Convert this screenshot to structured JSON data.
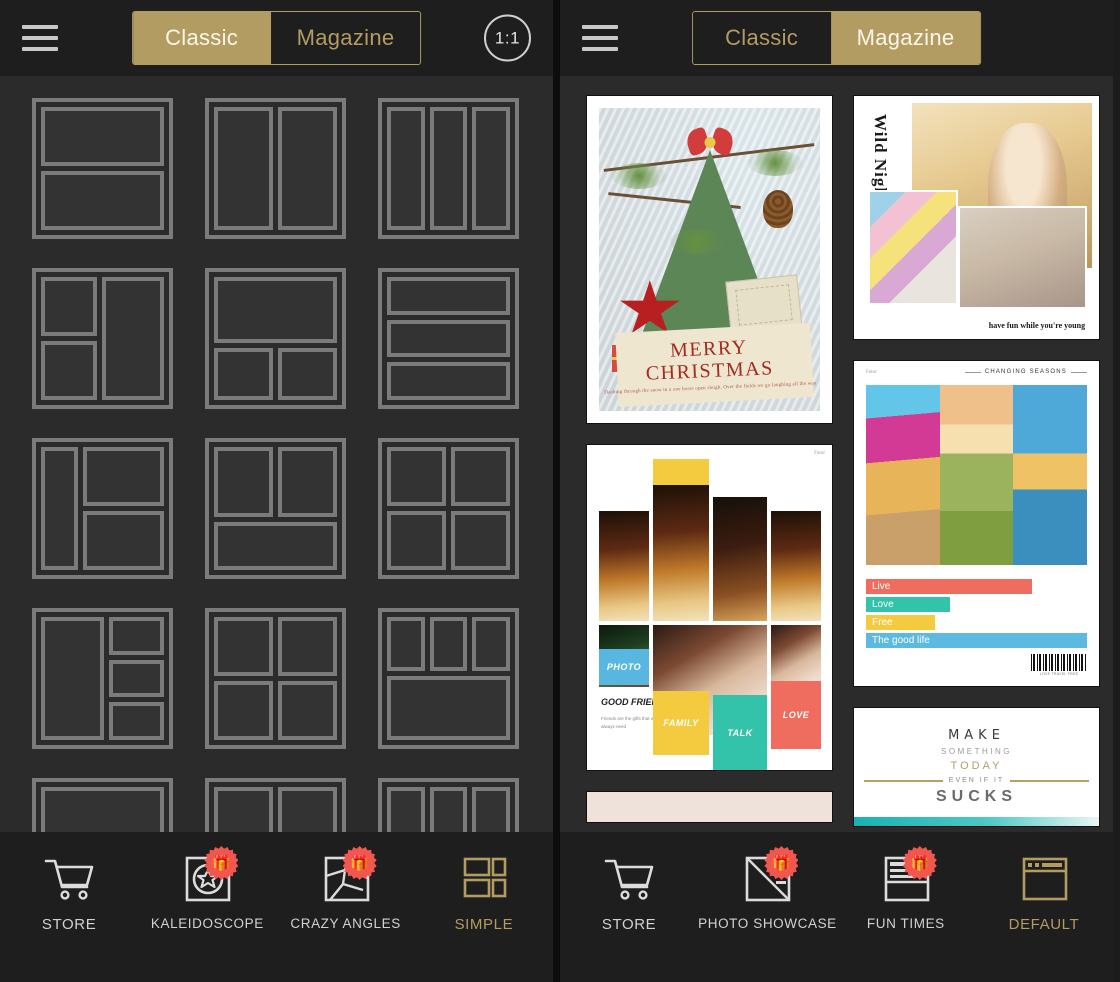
{
  "left_panel": {
    "header": {
      "menu_icon": "hamburger-icon",
      "tabs": [
        {
          "label": "Classic",
          "active": true
        },
        {
          "label": "Magazine",
          "active": false
        }
      ],
      "ratio_label": "1:1"
    },
    "layouts": [
      {
        "name": "two-rows"
      },
      {
        "name": "two-columns"
      },
      {
        "name": "three-columns"
      },
      {
        "name": "left-split-right-full"
      },
      {
        "name": "top-full-bottom-two"
      },
      {
        "name": "three-rows"
      },
      {
        "name": "narrow-left-right-split"
      },
      {
        "name": "top-two-bottom-full"
      },
      {
        "name": "two-by-two"
      },
      {
        "name": "left-full-right-three"
      },
      {
        "name": "quad-uneven"
      },
      {
        "name": "three-top-one-bottom"
      },
      {
        "name": "partial-row-a"
      },
      {
        "name": "partial-row-b"
      },
      {
        "name": "partial-row-c"
      }
    ],
    "toolbar": [
      {
        "label": "STORE",
        "icon": "cart-icon",
        "badge": false,
        "active": false
      },
      {
        "label": "KALEIDOSCOPE",
        "icon": "kaleidoscope-icon",
        "badge": true,
        "badge_icon": "gift-icon",
        "active": false
      },
      {
        "label": "CRAZY ANGLES",
        "icon": "crazy-angles-icon",
        "badge": true,
        "badge_icon": "gift-icon",
        "active": false
      },
      {
        "label": "SIMPLE",
        "icon": "simple-grid-icon",
        "badge": false,
        "active": true
      }
    ]
  },
  "right_panel": {
    "header": {
      "menu_icon": "hamburger-icon",
      "tabs": [
        {
          "label": "Classic",
          "active": false
        },
        {
          "label": "Magazine",
          "active": true
        }
      ]
    },
    "templates": {
      "christmas": {
        "title_line1": "MERRY",
        "title_line2": "CHRISTMAS",
        "subtitle": "Dashing through the snow in a one horse open sleigh, Over the fields we go laughing all the way"
      },
      "wild_nights": {
        "title": "Wild Nights",
        "caption": "have fun while you're young"
      },
      "good_friends": {
        "watermark": "Fotor",
        "photo_label": "PHOTO",
        "heading": "GOOD FRIENDS",
        "body": "Friends are the gifts that we always need",
        "labels": [
          {
            "text": "FAMILY",
            "color": "#f4ca3e"
          },
          {
            "text": "TALK",
            "color": "#33c3ab"
          },
          {
            "text": "LOVE",
            "color": "#ef6d5e"
          }
        ]
      },
      "changing_seasons": {
        "watermark": "Fotor",
        "heading": "CHANGING SEASONS",
        "bars": [
          {
            "text": "Live",
            "color": "#ef6d5e",
            "width": "75%"
          },
          {
            "text": "Love",
            "color": "#33c3ab",
            "width": "38%"
          },
          {
            "text": "Free",
            "color": "#f4ca3e",
            "width": "31%"
          },
          {
            "text": "The good life",
            "color": "#5cb9e0",
            "width": "100%"
          }
        ],
        "barcode_text": "LOVE TRAVEL FREE"
      },
      "make_something": {
        "line1": "MAKE",
        "line2": "SOMETHING",
        "line3": "TODAY",
        "line4": "EVEN IF IT",
        "line5": "SUCKS"
      }
    },
    "toolbar": [
      {
        "label": "STORE",
        "icon": "cart-icon",
        "badge": false,
        "active": false
      },
      {
        "label": "PHOTO SHOWCASE",
        "icon": "photo-showcase-icon",
        "badge": true,
        "badge_icon": "gift-icon",
        "active": false
      },
      {
        "label": "FUN TIMES",
        "icon": "fun-times-icon",
        "badge": true,
        "badge_icon": "gift-icon",
        "active": false
      },
      {
        "label": "DEFAULT",
        "icon": "default-layout-icon",
        "badge": false,
        "active": true
      }
    ]
  },
  "colors": {
    "gold": "#b39c61",
    "dark_bg": "#2b2b2b",
    "header_bg": "#1e1e1e",
    "badge_red": "#f2574f",
    "cell_stroke": "#7b7b7b"
  }
}
